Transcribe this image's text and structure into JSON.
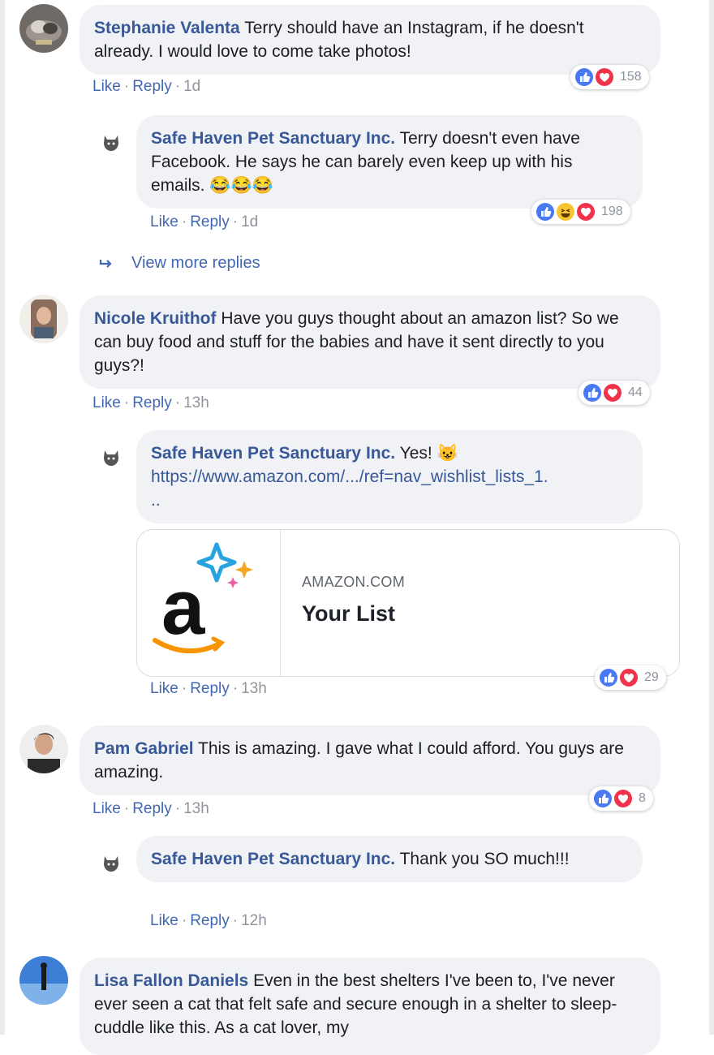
{
  "colors": {
    "author": "#385898",
    "action": "#4267b2",
    "bubble": "#f0f2f5",
    "like": "#4a79f6",
    "love": "#f0334a"
  },
  "comments": [
    {
      "author": "Stephanie Valenta",
      "text": "Terry should have an Instagram, if he doesn't already. I would love to come take photos!",
      "like": "Like",
      "reply": "Reply",
      "time": "1d",
      "reactions": [
        "like-icon",
        "love-icon"
      ],
      "count": "158",
      "reply_item": {
        "author": "Safe Haven Pet Sanctuary Inc.",
        "text": "Terry doesn't even have Facebook. He says he can barely even keep up with his emails.",
        "emoji": "😂😂😂",
        "like": "Like",
        "reply": "Reply",
        "time": "1d",
        "reactions": [
          "like-icon",
          "haha-icon",
          "love-icon"
        ],
        "count": "198"
      }
    },
    {
      "author": "Nicole Kruithof",
      "text": "Have you guys thought about an amazon list? So we can buy food and stuff for the babies and have it sent directly to you guys?!",
      "like": "Like",
      "reply": "Reply",
      "time": "13h",
      "reactions": [
        "like-icon",
        "love-icon"
      ],
      "count": "44",
      "reply_item": {
        "author": "Safe Haven Pet Sanctuary Inc.",
        "text": "Yes!",
        "emoji": "😺",
        "link": "https://www.amazon.com/.../ref=nav_wishlist_lists_1.",
        "link_tail": "..",
        "card": {
          "domain": "AMAZON.COM",
          "title": "Your List",
          "logo": "amazon-logo"
        },
        "like": "Like",
        "reply": "Reply",
        "time": "13h",
        "reactions": [
          "like-icon",
          "love-icon"
        ],
        "count": "29"
      }
    },
    {
      "author": "Pam Gabriel",
      "text": "This is amazing. I gave what I could afford. You guys are amazing.",
      "like": "Like",
      "reply": "Reply",
      "time": "13h",
      "reactions": [
        "like-icon",
        "love-icon"
      ],
      "count": "8",
      "reply_item": {
        "author": "Safe Haven Pet Sanctuary Inc.",
        "text": "Thank you SO much!!!",
        "like": "Like",
        "reply": "Reply",
        "time": "12h"
      }
    },
    {
      "author": "Lisa Fallon Daniels",
      "text": "Even in the best shelters I've been to, I've never ever seen a cat that felt safe and secure enough in a shelter to sleep-cuddle like this. As a cat lover, my"
    }
  ],
  "view_more_replies": "View more replies",
  "separator": "·"
}
